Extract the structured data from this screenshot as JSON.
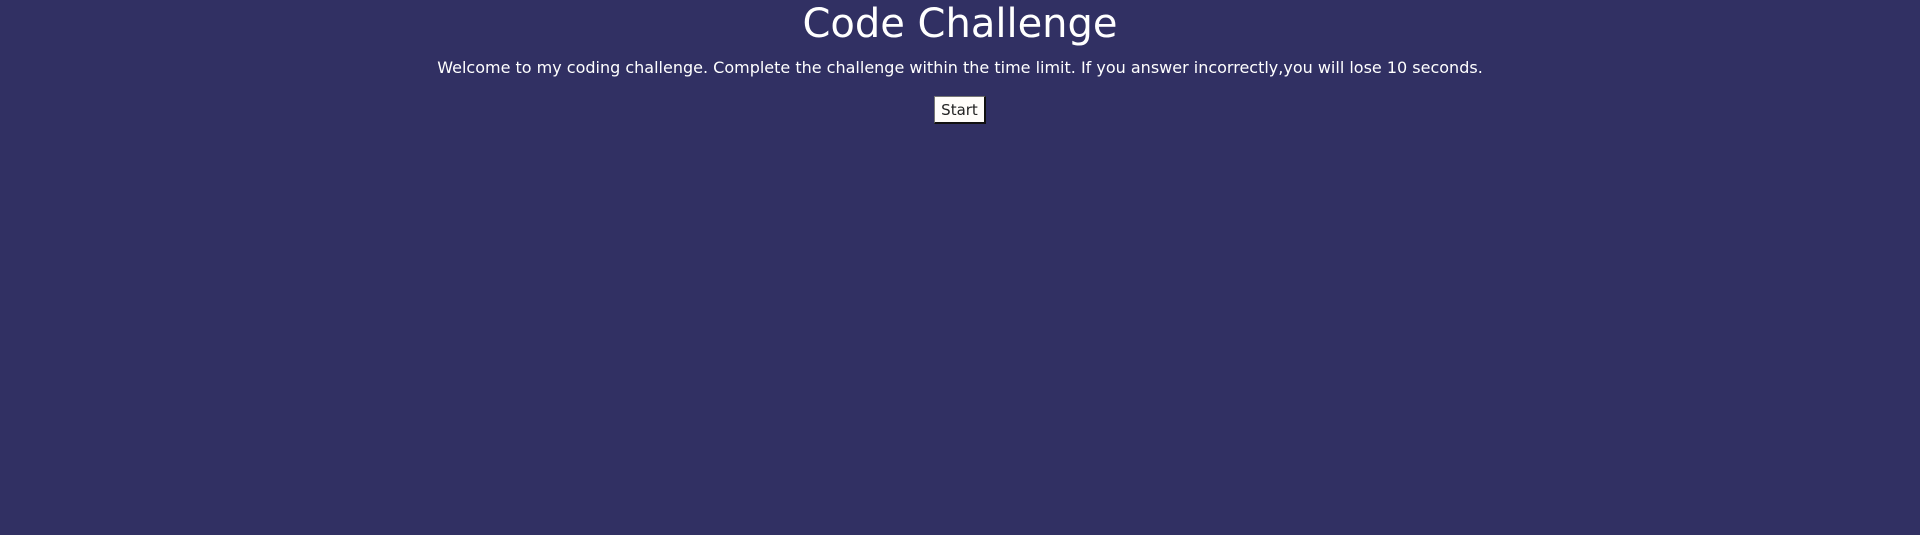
{
  "page": {
    "title": "Code Challenge",
    "description": "Welcome to my coding challenge. Complete the challenge within the time limit. If you answer incorrectly,you will lose 10 seconds.",
    "start_button_label": "Start"
  },
  "colors": {
    "background": "#313063",
    "text": "#ffffff",
    "button_background": "#fffdfa"
  }
}
